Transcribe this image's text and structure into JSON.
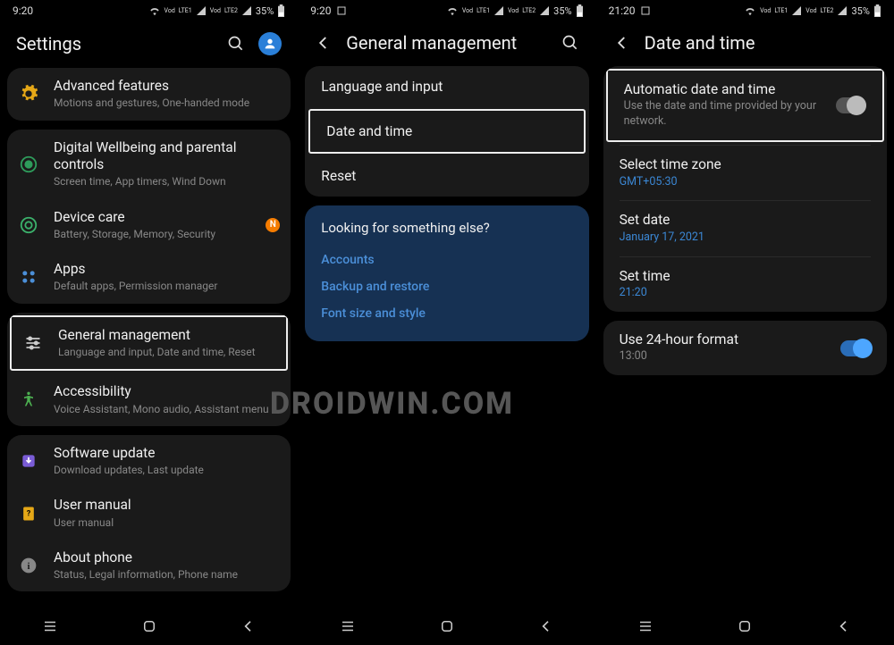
{
  "watermark": "DROIDWIN.COM",
  "status": {
    "time_a": "9:20",
    "time_b": "9:20",
    "time_c": "21:20",
    "battery": "35%",
    "carrier1": "Vod",
    "carrier2": "Vod",
    "lte1": "LTE1",
    "lte2": "LTE2"
  },
  "settings": {
    "title": "Settings",
    "items": [
      {
        "title": "Advanced features",
        "sub": "Motions and gestures, One-handed mode"
      },
      {
        "title": "Digital Wellbeing and parental controls",
        "sub": "Screen time, App timers, Wind Down"
      },
      {
        "title": "Device care",
        "sub": "Battery, Storage, Memory, Security",
        "badge": "N"
      },
      {
        "title": "Apps",
        "sub": "Default apps, Permission manager"
      },
      {
        "title": "General management",
        "sub": "Language and input, Date and time, Reset"
      },
      {
        "title": "Accessibility",
        "sub": "Voice Assistant, Mono audio, Assistant menu"
      },
      {
        "title": "Software update",
        "sub": "Download updates, Last update"
      },
      {
        "title": "User manual",
        "sub": "User manual"
      },
      {
        "title": "About phone",
        "sub": "Status, Legal information, Phone name"
      }
    ]
  },
  "gm": {
    "title": "General management",
    "items": [
      "Language and input",
      "Date and time",
      "Reset"
    ],
    "looking_title": "Looking for something else?",
    "looking_links": [
      "Accounts",
      "Backup and restore",
      "Font size and style"
    ]
  },
  "dt": {
    "title": "Date and time",
    "auto_title": "Automatic date and time",
    "auto_sub": "Use the date and time provided by your network.",
    "tz_title": "Select time zone",
    "tz_sub": "GMT+05:30",
    "date_title": "Set date",
    "date_sub": "January 17, 2021",
    "time_title": "Set time",
    "time_sub": "21:20",
    "h24_title": "Use 24-hour format",
    "h24_sub": "13:00"
  }
}
